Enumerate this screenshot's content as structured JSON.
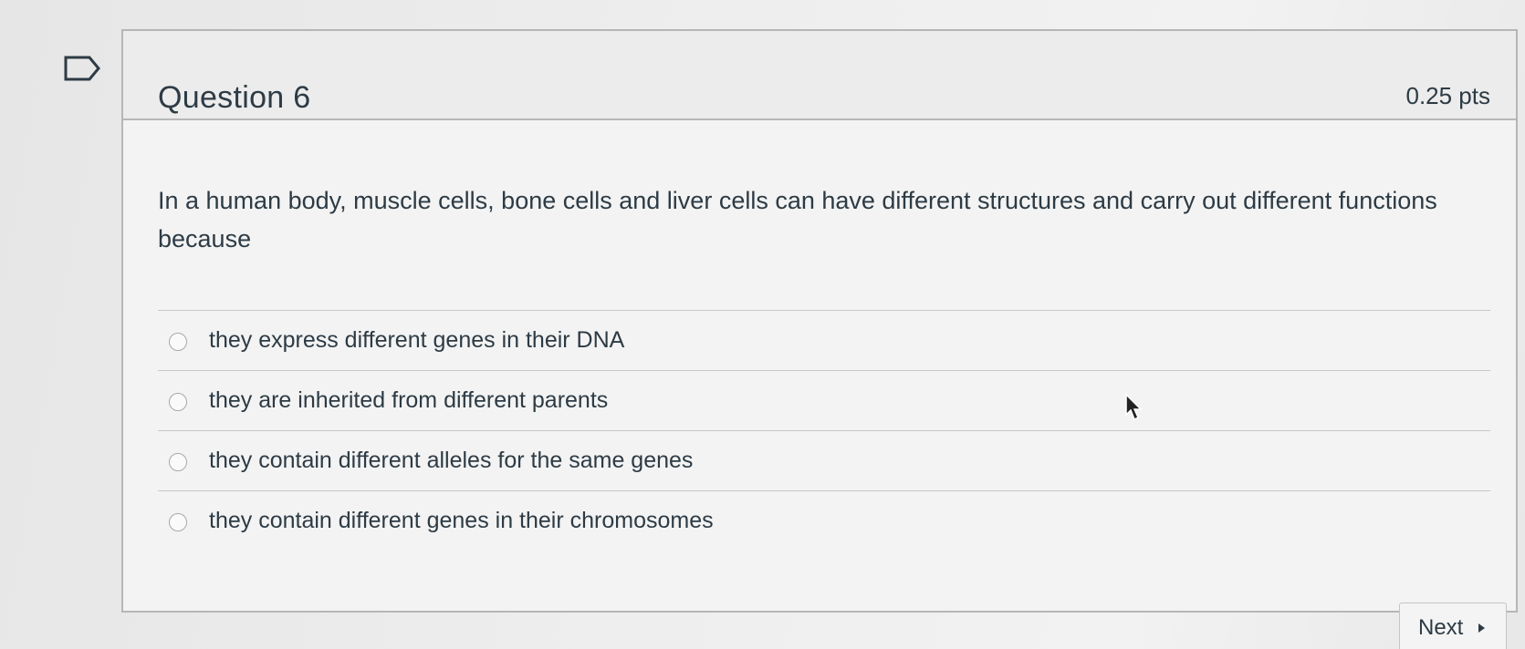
{
  "question": {
    "title": "Question 6",
    "points": "0.25 pts",
    "text": "In a human body, muscle cells, bone cells and liver cells can have different structures and carry out different functions because",
    "answers": [
      {
        "label": "they express different genes in their DNA"
      },
      {
        "label": "they are inherited from different parents"
      },
      {
        "label": "they contain different alleles for the same genes"
      },
      {
        "label": "they contain different genes in their chromosomes"
      }
    ]
  },
  "navigation": {
    "next_label": "Next"
  },
  "icons": {
    "flag": "flag-icon",
    "cursor": "mouse-pointer-icon",
    "next_arrow": "caret-right-icon"
  },
  "colors": {
    "text": "#2d3b45",
    "border": "#b6b6b6",
    "header_background": "#ececec"
  }
}
